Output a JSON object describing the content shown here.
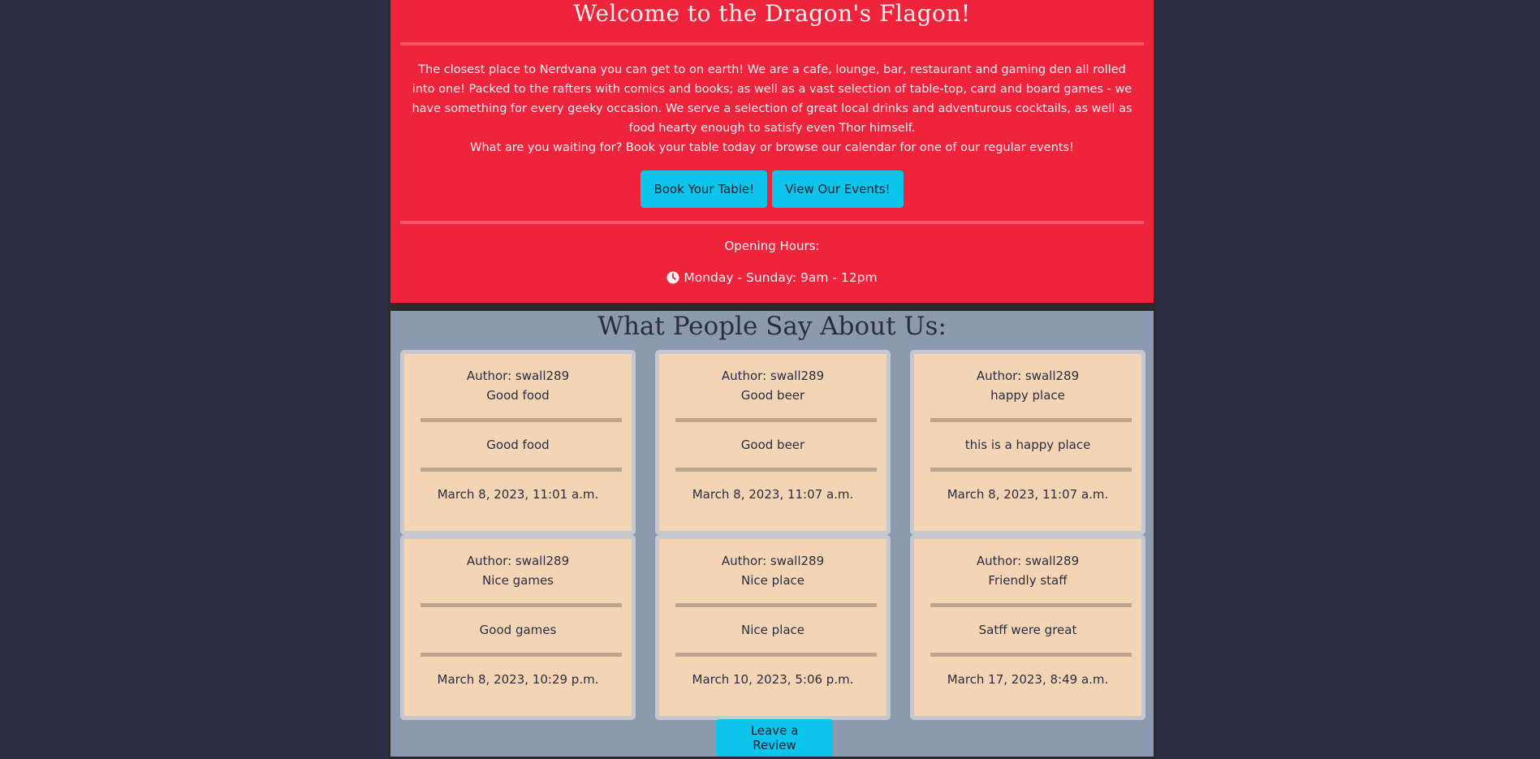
{
  "hero": {
    "title": "Welcome to the Dragon's Flagon!",
    "intro_paragraph_1": "The closest place to Nerdvana you can get to on earth! We are a cafe, lounge, bar, restaurant and gaming den all rolled into one! Packed to the rafters with comics and books; as well as a vast selection of table-top, card and board games - we have something for every geeky occasion. We serve a selection of great local drinks and adventurous cocktails, as well as food hearty enough to satisfy even Thor himself.",
    "intro_paragraph_2": "What are you waiting for? Book your table today or browse our calendar for one of our regular events!",
    "book_button": "Book Your Table!",
    "events_button": "View Our Events!",
    "hours_label": "Opening Hours:",
    "hours_value": "Monday - Sunday: 9am - 12pm",
    "hours_icon": "clock-icon"
  },
  "reviews": {
    "title": "What People Say About Us:",
    "items": [
      {
        "author": "Author: swall289",
        "subject": "Good food",
        "body": "Good food",
        "date": "March 8, 2023, 11:01 a.m."
      },
      {
        "author": "Author: swall289",
        "subject": "Good beer",
        "body": "Good beer",
        "date": "March 8, 2023, 11:07 a.m."
      },
      {
        "author": "Author: swall289",
        "subject": "happy place",
        "body": "this is a happy place",
        "date": "March 8, 2023, 11:07 a.m."
      },
      {
        "author": "Author: swall289",
        "subject": "Nice games",
        "body": "Good games",
        "date": "March 8, 2023, 10:29 p.m."
      },
      {
        "author": "Author: swall289",
        "subject": "Nice place",
        "body": "Nice place",
        "date": "March 10, 2023, 5:06 p.m."
      },
      {
        "author": "Author: swall289",
        "subject": "Friendly staff",
        "body": "Satff were great",
        "date": "March 17, 2023, 8:49 a.m."
      }
    ],
    "leave_button": "Leave a Review"
  },
  "colors": {
    "hero_bg": "#ef233c",
    "reviews_bg": "#8d99ae",
    "card_bg": "#f3d5b5",
    "button_bg": "#0dc4eb",
    "page_bg": "#2b2e44"
  }
}
